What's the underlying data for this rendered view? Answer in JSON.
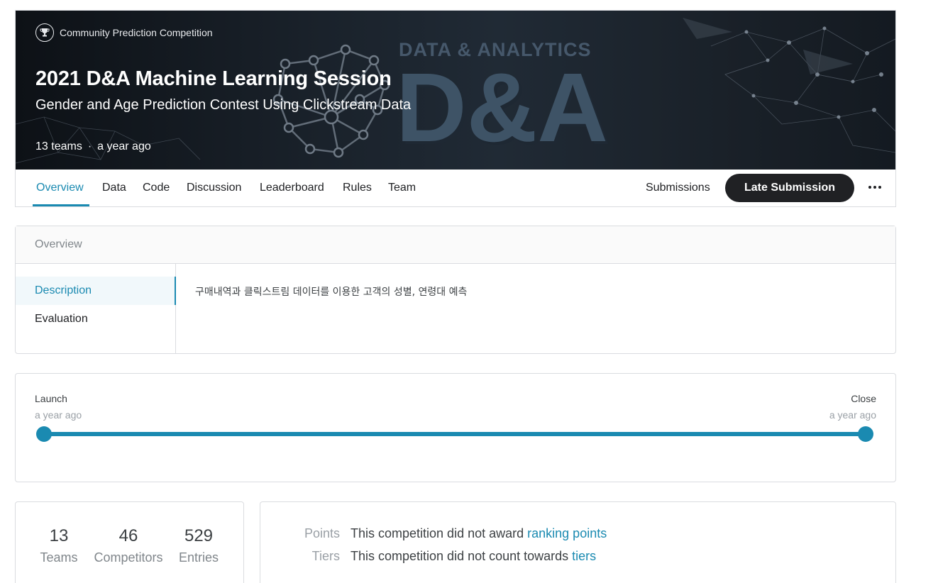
{
  "header": {
    "host_label": "Community Prediction Competition",
    "title": "2021 D&A Machine Learning Session",
    "subtitle": "Gender and Age Prediction Contest Using Clickstream Data",
    "teams": "13 teams",
    "separator": "·",
    "time": "a year ago",
    "banner_text_small": "DATA & ANALYTICS",
    "banner_text_big": "D&A"
  },
  "tabs": [
    {
      "label": "Overview",
      "active": true
    },
    {
      "label": "Data"
    },
    {
      "label": "Code"
    },
    {
      "label": "Discussion"
    },
    {
      "label": "Leaderboard"
    },
    {
      "label": "Rules"
    },
    {
      "label": "Team"
    }
  ],
  "actions": {
    "submissions_label": "Submissions",
    "late_submission_label": "Late Submission"
  },
  "overview": {
    "heading": "Overview",
    "nav": [
      {
        "label": "Description",
        "active": true
      },
      {
        "label": "Evaluation"
      }
    ],
    "description": "구매내역과 클릭스트림 데이터를 이용한 고객의 성별, 연령대 예측"
  },
  "timeline": {
    "launch_label": "Launch",
    "launch_time": "a year ago",
    "close_label": "Close",
    "close_time": "a year ago"
  },
  "stats": [
    {
      "value": "13",
      "label": "Teams"
    },
    {
      "value": "46",
      "label": "Competitors"
    },
    {
      "value": "529",
      "label": "Entries"
    }
  ],
  "awards": {
    "points_key": "Points",
    "points_text": "This competition did not award ",
    "points_link": "ranking points",
    "tiers_key": "Tiers",
    "tiers_text": "This competition did not count towards ",
    "tiers_link": "tiers"
  },
  "colors": {
    "accent": "#1a8ab1",
    "button_dark": "#202124",
    "banner_bg": "#1a222b"
  }
}
